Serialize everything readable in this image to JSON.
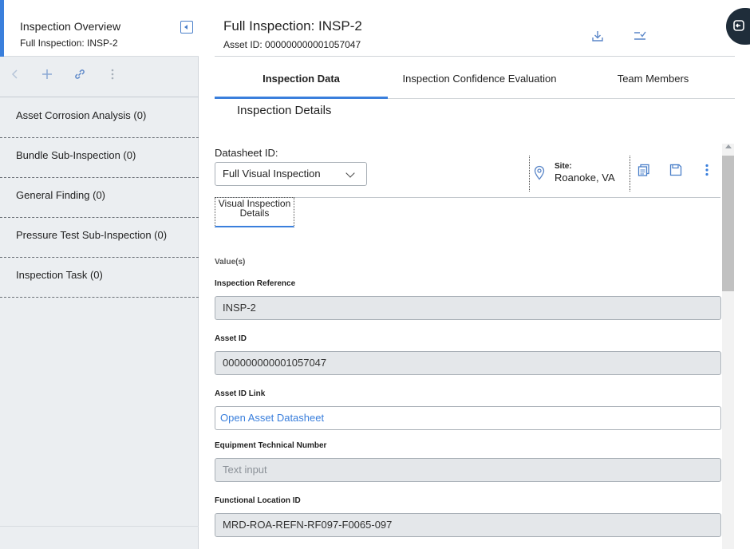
{
  "sidebar": {
    "title": "Inspection Overview",
    "subtitle": "Full Inspection: INSP-2",
    "items": [
      {
        "label": "Asset Corrosion Analysis (0)"
      },
      {
        "label": "Bundle Sub-Inspection (0)"
      },
      {
        "label": "General Finding (0)"
      },
      {
        "label": "Pressure Test Sub-Inspection (0)"
      },
      {
        "label": "Inspection Task (0)"
      }
    ]
  },
  "header": {
    "title": "Full Inspection: INSP-2",
    "asset_line": "Asset ID: 000000000001057047"
  },
  "tabs": [
    {
      "label": "Inspection Data",
      "active": true
    },
    {
      "label": "Inspection Confidence Evaluation",
      "active": false
    },
    {
      "label": "Team Members",
      "active": false
    }
  ],
  "section": {
    "title": "Inspection Details"
  },
  "datasheet": {
    "label": "Datasheet ID:",
    "selected": "Full Visual Inspection"
  },
  "site": {
    "label": "Site:",
    "value": "Roanoke, VA"
  },
  "subtab": {
    "label": "Visual Inspection Details"
  },
  "form": {
    "values_label": "Value(s)",
    "fields": [
      {
        "label": "Inspection Reference",
        "value": "INSP-2"
      },
      {
        "label": "Asset ID",
        "value": "000000000001057047"
      },
      {
        "label": "Asset ID Link",
        "value": "Open Asset Datasheet"
      },
      {
        "label": "Equipment Technical Number",
        "value": "Text input"
      },
      {
        "label": "Functional Location ID",
        "value": "MRD-ROA-REFN-RF097-F0065-097"
      }
    ]
  },
  "colors": {
    "accent": "#3a7fdc",
    "sidebar_bg": "#ebeef1",
    "readonly_field": "#e4e7ea"
  },
  "icons": [
    "collapse-icon",
    "back-icon",
    "add-icon",
    "link-icon",
    "more-vertical-icon",
    "download-icon",
    "checklist-icon",
    "exit-icon",
    "location-pin-icon",
    "copy-icon",
    "save-icon"
  ]
}
